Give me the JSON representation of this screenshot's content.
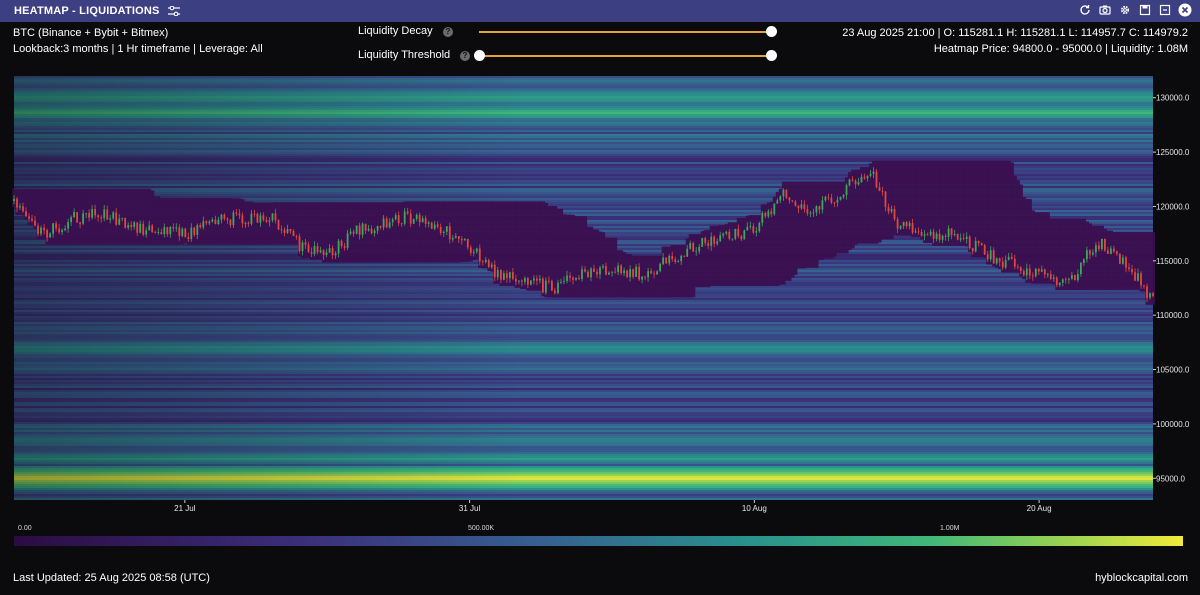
{
  "window": {
    "title": "HEATMAP - LIQUIDATIONS",
    "icons": [
      "settings-sliders-icon",
      "refresh-icon",
      "camera-icon",
      "gear-icon",
      "save-icon",
      "fullscreen-icon",
      "close-icon"
    ]
  },
  "info": {
    "exchanges": "BTC (Binance + Bybit + Bitmex)",
    "lookback": "Lookback:3 months | 1 Hr timeframe | Leverage: All",
    "ohlc": "23 Aug 2025 21:00 | O: 115281.1 H: 115281.1 L: 114957.7 C: 114979.2",
    "heatmap": "Heatmap Price: 94800.0 - 95000.0 | Liquidity: 1.08M"
  },
  "controls": {
    "decay_label": "Liquidity Decay",
    "decay_value": 1.0,
    "threshold_label": "Liquidity Threshold",
    "threshold_range": [
      0.0,
      1.0
    ],
    "help_glyph": "?"
  },
  "chart_data": {
    "type": "heatmap",
    "x_ticks": [
      "21 Jul",
      "31 Jul",
      "10 Aug",
      "20 Aug"
    ],
    "y_ticks": [
      "130000.0",
      "125000.0",
      "120000.0",
      "115000.0",
      "110000.0",
      "105000.0",
      "100000.0",
      "95000.0"
    ],
    "x_range": [
      "2025-07-15",
      "2025-08-24"
    ],
    "y_range": [
      93000,
      132000
    ],
    "grid": false,
    "colorbar_ticks": [
      "0.00",
      "500.00K",
      "1.00M"
    ],
    "colorbar_range": [
      0,
      1150000
    ],
    "colorscale": [
      "#2a0c42",
      "#3b2f7a",
      "#36608f",
      "#2a8f8c",
      "#3fb67a",
      "#9ad352",
      "#f2ea3a"
    ],
    "candle_up_color": "#3fa65a",
    "candle_down_color": "#e0483e",
    "price_path": [
      [
        "2025-07-15",
        120500
      ],
      [
        "2025-07-16",
        117500
      ],
      [
        "2025-07-17",
        118800
      ],
      [
        "2025-07-18",
        119600
      ],
      [
        "2025-07-19",
        118000
      ],
      [
        "2025-07-20",
        117700
      ],
      [
        "2025-07-21",
        117400
      ],
      [
        "2025-07-22",
        118800
      ],
      [
        "2025-07-23",
        118900
      ],
      [
        "2025-07-24",
        119000
      ],
      [
        "2025-07-25",
        116500
      ],
      [
        "2025-07-26",
        115500
      ],
      [
        "2025-07-27",
        117600
      ],
      [
        "2025-07-28",
        118500
      ],
      [
        "2025-07-29",
        119100
      ],
      [
        "2025-07-30",
        118000
      ],
      [
        "2025-07-31",
        116400
      ],
      [
        "2025-08-01",
        113800
      ],
      [
        "2025-08-02",
        113000
      ],
      [
        "2025-08-03",
        112400
      ],
      [
        "2025-08-04",
        113800
      ],
      [
        "2025-08-05",
        114500
      ],
      [
        "2025-08-06",
        113700
      ],
      [
        "2025-08-07",
        114900
      ],
      [
        "2025-08-08",
        116500
      ],
      [
        "2025-08-09",
        117200
      ],
      [
        "2025-08-10",
        117800
      ],
      [
        "2025-08-11",
        121200
      ],
      [
        "2025-08-12",
        119500
      ],
      [
        "2025-08-13",
        121000
      ],
      [
        "2025-08-14",
        123500
      ],
      [
        "2025-08-15",
        118500
      ],
      [
        "2025-08-16",
        117300
      ],
      [
        "2025-08-17",
        117800
      ],
      [
        "2025-08-18",
        115800
      ],
      [
        "2025-08-19",
        114700
      ],
      [
        "2025-08-20",
        113800
      ],
      [
        "2025-08-21",
        112800
      ],
      [
        "2025-08-22",
        116800
      ],
      [
        "2025-08-23",
        114900
      ],
      [
        "2025-08-24",
        111500
      ]
    ],
    "bands": [
      {
        "low": 94300,
        "high": 95700,
        "level": 1.0
      },
      {
        "low": 96500,
        "high": 97200,
        "level": 0.6
      },
      {
        "low": 98200,
        "high": 99000,
        "level": 0.52
      },
      {
        "low": 106300,
        "high": 107500,
        "level": 0.55
      },
      {
        "low": 104800,
        "high": 105400,
        "level": 0.45
      },
      {
        "low": 108500,
        "high": 109200,
        "level": 0.38
      },
      {
        "low": 125300,
        "high": 125800,
        "level": 0.42
      },
      {
        "low": 128300,
        "high": 129000,
        "level": 0.75
      },
      {
        "low": 129400,
        "high": 130700,
        "level": 0.6
      },
      {
        "low": 131300,
        "high": 131700,
        "level": 0.45
      }
    ]
  },
  "colorbar": {
    "tick_0": "0.00",
    "tick_1": "500.00K",
    "tick_2": "1.00M"
  },
  "footer": {
    "updated": "Last Updated: 25 Aug 2025 08:58 (UTC)",
    "brand": "hyblockcapital.com"
  }
}
